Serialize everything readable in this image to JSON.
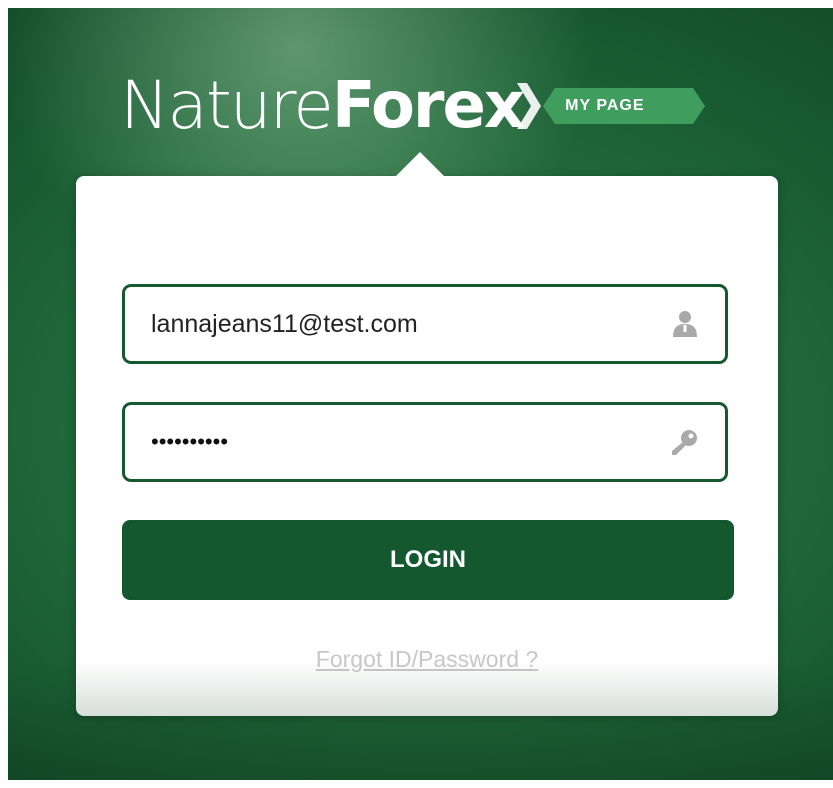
{
  "logo": {
    "brand_light": "Nature",
    "brand_bold": "Forex",
    "badge": "MY PAGE"
  },
  "login_form": {
    "email_value": "lannajeans11@test.com",
    "email_icon": "user-icon",
    "password_value": "••••••••••",
    "password_icon": "key-icon",
    "login_label": "LOGIN",
    "forgot_label": "Forgot ID/Password ?"
  },
  "colors": {
    "brand_green": "#13582f",
    "badge_green": "#3a9a5a",
    "link_gray": "#c8c8c8"
  }
}
